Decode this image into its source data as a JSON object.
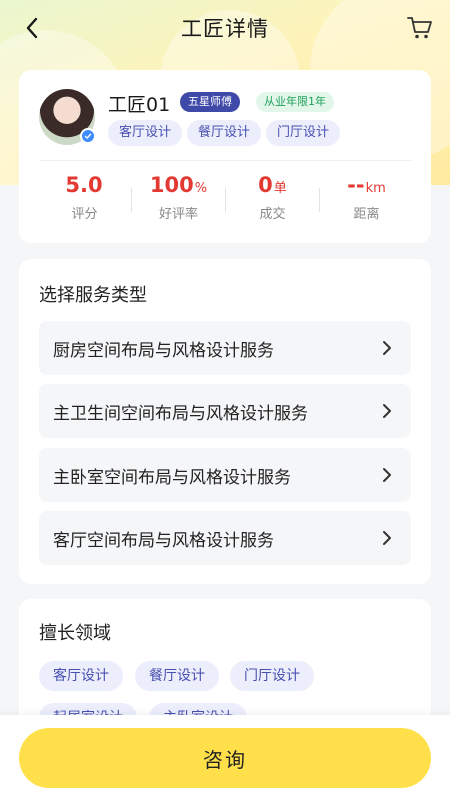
{
  "nav": {
    "title": "工匠详情",
    "back_icon": "chevron-left-icon",
    "cart_icon": "shopping-cart-icon"
  },
  "profile": {
    "name": "工匠01",
    "level_badge": "五星师傅",
    "years_badge": "从业年限1年",
    "tags": [
      "客厅设计",
      "餐厅设计",
      "门厅设计"
    ],
    "stats": [
      {
        "value": "5.0",
        "unit": "",
        "label": "评分"
      },
      {
        "value": "100",
        "unit": "%",
        "label": "好评率"
      },
      {
        "value": "0",
        "unit": "单",
        "label": "成交"
      },
      {
        "value": "--",
        "unit": "km",
        "label": "距离"
      }
    ],
    "verified_icon": "check-badge-icon"
  },
  "services": {
    "title": "选择服务类型",
    "items": [
      {
        "label": "厨房空间布局与风格设计服务"
      },
      {
        "label": "主卫生间空间布局与风格设计服务"
      },
      {
        "label": "主卧室空间布局与风格设计服务"
      },
      {
        "label": "客厅空间布局与风格设计服务"
      }
    ]
  },
  "expertise": {
    "title": "擅长领域",
    "tags": [
      "客厅设计",
      "餐厅设计",
      "门厅设计",
      "起居室设计",
      "主卧室设计"
    ]
  },
  "bottom": {
    "consult_label": "咨询"
  },
  "colors": {
    "accent_yellow": "#ffe04a",
    "stat_red": "#e23a32",
    "badge_blue": "#3f4aa8",
    "badge_green": "#1fa05a",
    "tag_text": "#4851b0"
  }
}
